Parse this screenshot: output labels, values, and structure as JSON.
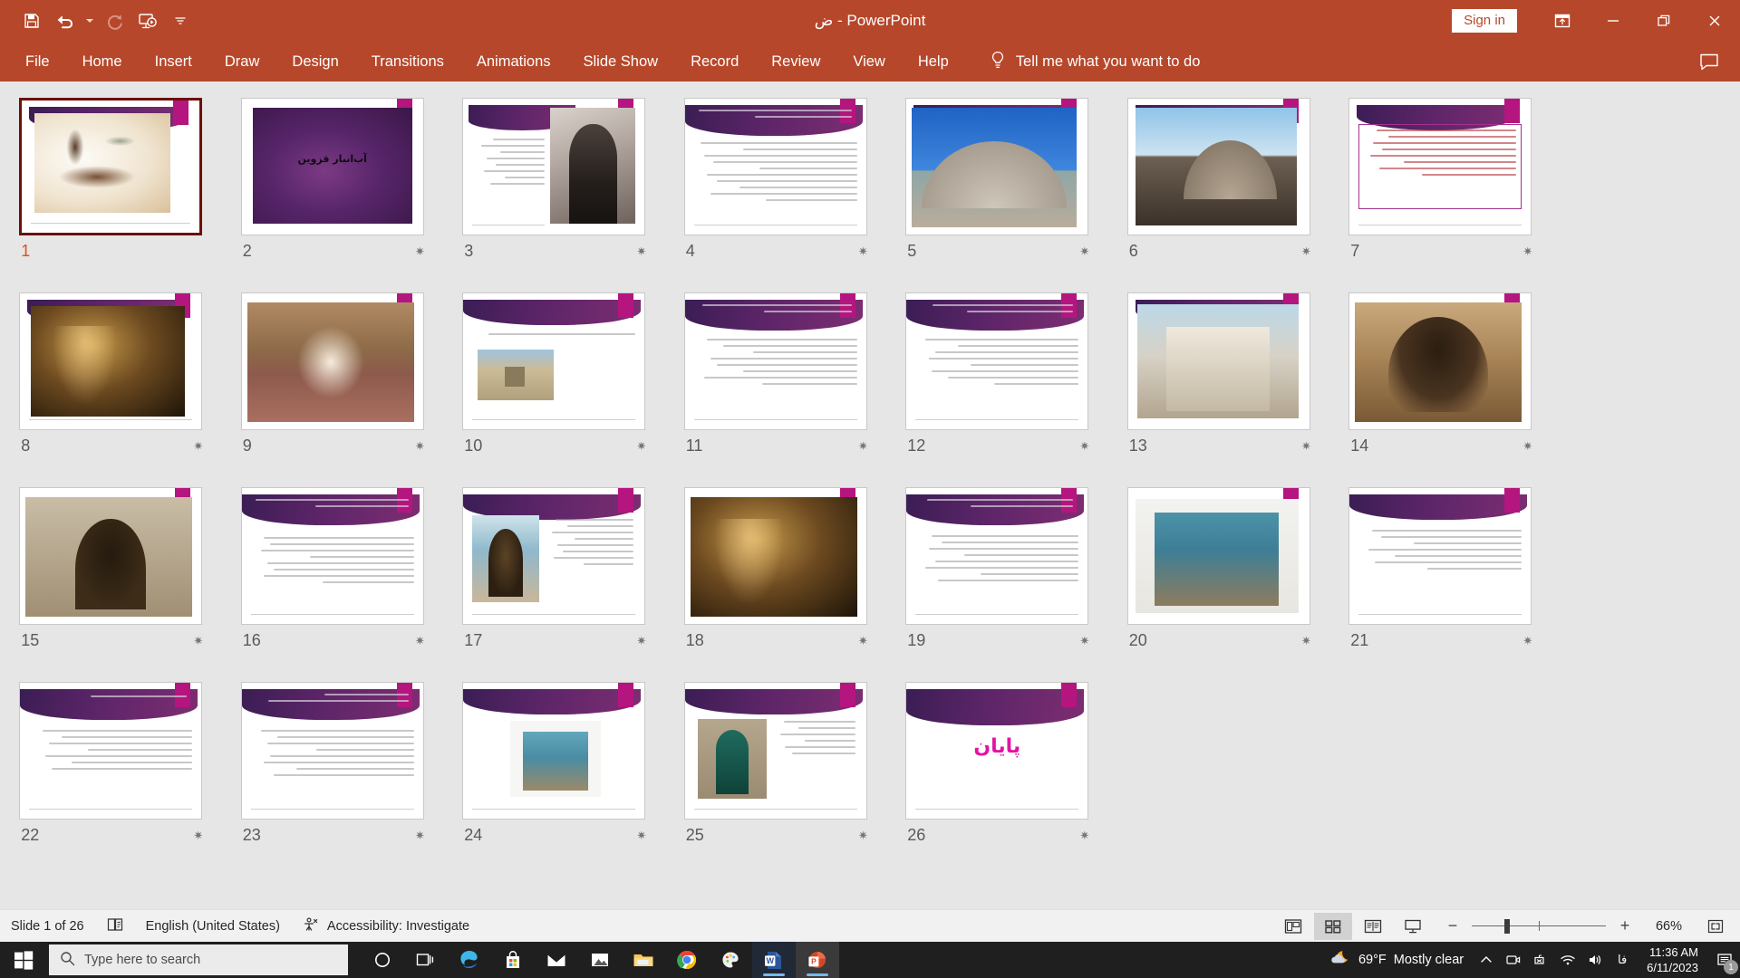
{
  "titlebar": {
    "document_title": "ض  -  PowerPoint",
    "quick_access": [
      {
        "name": "save-button",
        "label": "Save"
      },
      {
        "name": "undo-button",
        "label": "Undo"
      },
      {
        "name": "undo-dropdown",
        "label": "Undo options"
      },
      {
        "name": "redo-button",
        "label": "Redo"
      },
      {
        "name": "start-presentation-button",
        "label": "Start From Beginning"
      },
      {
        "name": "customize-qat-button",
        "label": "Customize Quick Access Toolbar"
      }
    ],
    "sign_in_label": "Sign in",
    "ribbon_display_label": "Ribbon Display Options",
    "minimize_label": "Minimize",
    "restore_label": "Restore Down",
    "close_label": "Close"
  },
  "ribbon": {
    "tabs": [
      {
        "label": "File"
      },
      {
        "label": "Home"
      },
      {
        "label": "Insert"
      },
      {
        "label": "Draw"
      },
      {
        "label": "Design"
      },
      {
        "label": "Transitions"
      },
      {
        "label": "Animations"
      },
      {
        "label": "Slide Show"
      },
      {
        "label": "Record"
      },
      {
        "label": "Review"
      },
      {
        "label": "View"
      },
      {
        "label": "Help"
      }
    ],
    "tell_me": "Tell me what you want to do",
    "comments_label": "Comments"
  },
  "status": {
    "slide_counter": "Slide 1 of 26",
    "notes_label": "Notes",
    "language": "English (United States)",
    "accessibility": "Accessibility: Investigate",
    "views": [
      {
        "name": "view-normal",
        "label": "Normal",
        "active": false
      },
      {
        "name": "view-slide-sorter",
        "label": "Slide Sorter",
        "active": true
      },
      {
        "name": "view-reading",
        "label": "Reading View",
        "active": false
      },
      {
        "name": "view-slideshow",
        "label": "Slide Show",
        "active": false
      }
    ],
    "zoom_out_label": "Zoom Out",
    "zoom_in_label": "Zoom In",
    "zoom_percent": "66%",
    "fit_label": "Fit slide to current window"
  },
  "taskbar": {
    "search_placeholder": "Type here to search",
    "apps": [
      {
        "name": "cortana-icon",
        "label": "Cortana"
      },
      {
        "name": "task-view-icon",
        "label": "Task View"
      },
      {
        "name": "edge-icon",
        "label": "Microsoft Edge"
      },
      {
        "name": "microsoft-store-icon",
        "label": "Microsoft Store"
      },
      {
        "name": "mail-icon",
        "label": "Mail"
      },
      {
        "name": "photos-icon",
        "label": "Photos"
      },
      {
        "name": "file-explorer-icon",
        "label": "File Explorer"
      },
      {
        "name": "chrome-icon",
        "label": "Google Chrome"
      },
      {
        "name": "paint-3d-icon",
        "label": "Paint 3D"
      },
      {
        "name": "word-icon",
        "label": "Word"
      },
      {
        "name": "powerpoint-icon",
        "label": "PowerPoint"
      }
    ],
    "weather_temp": "69°F",
    "weather_desc": "Mostly clear",
    "time": "11:36 AM",
    "date": "6/11/2023",
    "notification_count": "1"
  },
  "slides": [
    {
      "num": "1",
      "kind": "image-title",
      "photo": "ph-calli",
      "selected": true,
      "starred": false
    },
    {
      "num": "2",
      "kind": "title",
      "photo": "ph-purple",
      "title": "آب‌انبار قزوین",
      "selected": false,
      "starred": true
    },
    {
      "num": "3",
      "kind": "text-image",
      "photo": "ph-sepia",
      "selected": false,
      "starred": true
    },
    {
      "num": "4",
      "kind": "text-band",
      "selected": false,
      "starred": true
    },
    {
      "num": "5",
      "kind": "image-full",
      "photo": "ph-dome",
      "selected": false,
      "starred": true
    },
    {
      "num": "6",
      "kind": "image-full",
      "photo": "ph-dome2",
      "selected": false,
      "starred": true
    },
    {
      "num": "7",
      "kind": "text-selected",
      "selected": false,
      "starred": true
    },
    {
      "num": "8",
      "kind": "image-full",
      "photo": "ph-cave",
      "selected": false,
      "starred": true
    },
    {
      "num": "9",
      "kind": "image-full",
      "photo": "ph-vault",
      "selected": false,
      "starred": true
    },
    {
      "num": "10",
      "kind": "text-image-sm",
      "photo": "ph-field",
      "selected": false,
      "starred": true
    },
    {
      "num": "11",
      "kind": "text-band",
      "selected": false,
      "starred": true
    },
    {
      "num": "12",
      "kind": "text-band",
      "selected": false,
      "starred": true
    },
    {
      "num": "13",
      "kind": "image-full",
      "photo": "ph-court",
      "selected": false,
      "starred": true
    },
    {
      "num": "14",
      "kind": "image-full",
      "photo": "ph-brick",
      "selected": false,
      "starred": true
    },
    {
      "num": "15",
      "kind": "image-full",
      "photo": "ph-arch",
      "selected": false,
      "starred": true
    },
    {
      "num": "16",
      "kind": "text-band",
      "selected": false,
      "starred": true
    },
    {
      "num": "17",
      "kind": "text-image",
      "photo": "ph-tile",
      "selected": false,
      "starred": true
    },
    {
      "num": "18",
      "kind": "image-full",
      "photo": "ph-cave",
      "selected": false,
      "starred": true
    },
    {
      "num": "19",
      "kind": "text-band",
      "selected": false,
      "starred": true
    },
    {
      "num": "20",
      "kind": "image-full",
      "photo": "ph-mosque",
      "selected": false,
      "starred": true
    },
    {
      "num": "21",
      "kind": "text-band",
      "selected": false,
      "starred": true
    },
    {
      "num": "22",
      "kind": "text-band",
      "selected": false,
      "starred": true
    },
    {
      "num": "23",
      "kind": "text-band",
      "selected": false,
      "starred": true
    },
    {
      "num": "24",
      "kind": "text-image-sm",
      "photo": "ph-mosque2",
      "selected": false,
      "starred": true
    },
    {
      "num": "25",
      "kind": "text-image-sm",
      "photo": "ph-door",
      "selected": false,
      "starred": true
    },
    {
      "num": "26",
      "kind": "end",
      "title": "پایان",
      "selected": false,
      "starred": true
    }
  ],
  "theme": {
    "ribbon_color": "#b7472a",
    "selection_border": "#6b1008",
    "selected_number": "#d94f1e",
    "slide_band": "#5c2568",
    "slide_tag": "#b5157e",
    "end_text": "#e313a4"
  }
}
